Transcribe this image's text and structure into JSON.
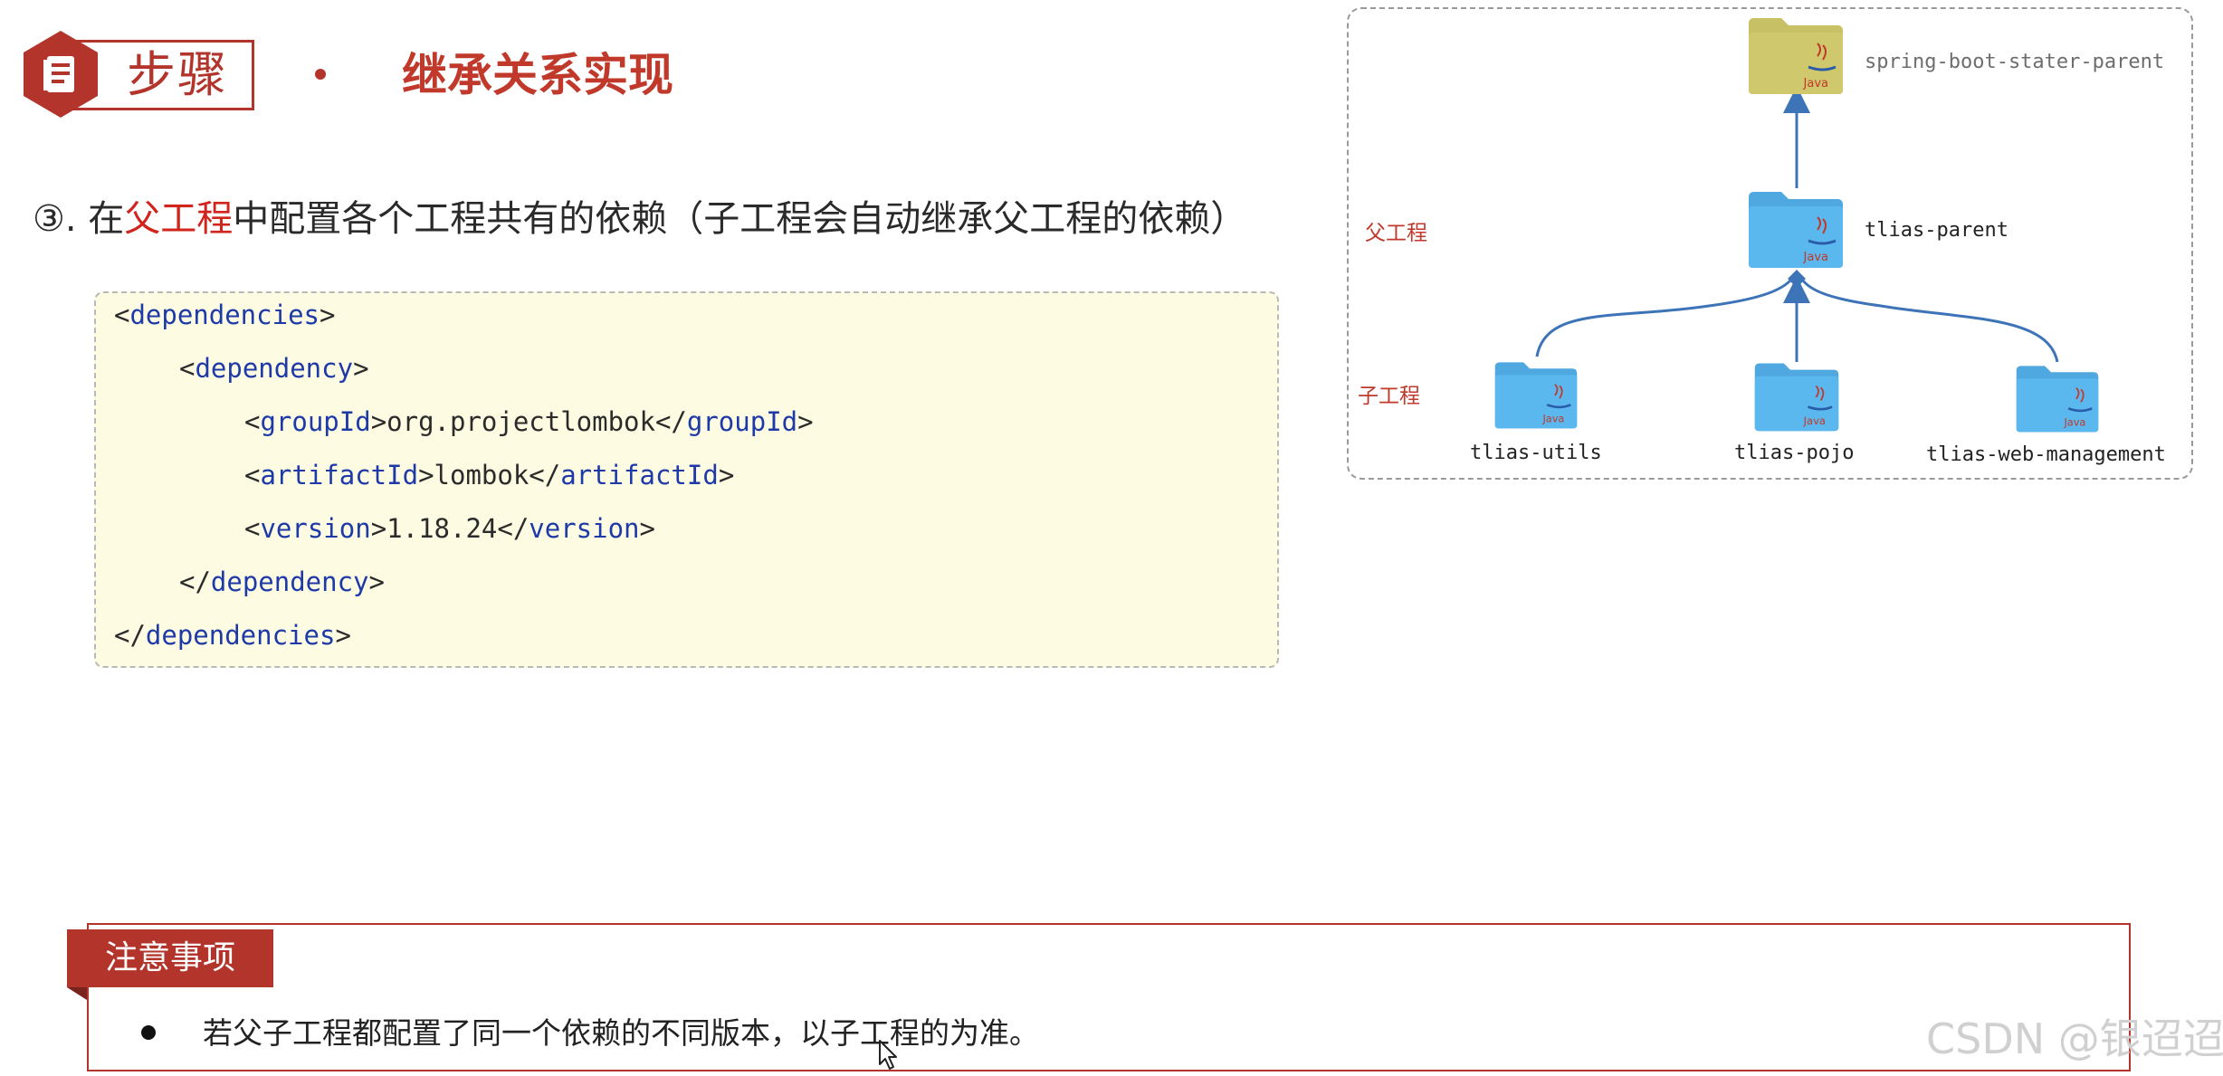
{
  "header": {
    "step_label": "步骤",
    "title": "继承关系实现"
  },
  "instruction": {
    "prefix": "③. 在",
    "highlight": "父工程",
    "suffix": "中配置各个工程共有的依赖（子工程会自动继承父工程的依赖）"
  },
  "code": {
    "lines": [
      {
        "before": "<",
        "tag": "dependencies",
        "middle": ">",
        "tag2": "",
        "after": ""
      },
      {
        "before": "<",
        "tag": "dependency",
        "middle": ">",
        "tag2": "",
        "after": ""
      },
      {
        "before": "<",
        "tag": "groupId",
        "middle": ">org.projectlombok</",
        "tag2": "groupId",
        "after": ">"
      },
      {
        "before": "<",
        "tag": "artifactId",
        "middle": ">lombok</",
        "tag2": "artifactId",
        "after": ">"
      },
      {
        "before": "<",
        "tag": "version",
        "middle": ">1.18.24</",
        "tag2": "version",
        "after": ">"
      },
      {
        "before": "</",
        "tag": "dependency",
        "middle": ">",
        "tag2": "",
        "after": ""
      },
      {
        "before": "</",
        "tag": "dependencies",
        "middle": ">",
        "tag2": "",
        "after": ""
      }
    ]
  },
  "diagram": {
    "parent_group_label": "父工程",
    "child_group_label": "子工程",
    "nodes": {
      "root": {
        "label": "spring-boot-stater-parent",
        "badge": "Java",
        "color": "#c7c064"
      },
      "parent": {
        "label": "tlias-parent",
        "badge": "Java",
        "color": "#5ab8ee"
      },
      "child1": {
        "label": "tlias-utils",
        "badge": "Java",
        "color": "#5ab8ee"
      },
      "child2": {
        "label": "tlias-pojo",
        "badge": "Java",
        "color": "#5ab8ee"
      },
      "child3": {
        "label": "tlias-web-management",
        "badge": "Java",
        "color": "#5ab8ee"
      }
    },
    "arrow_color": "#3d74b8"
  },
  "notice": {
    "header": "注意事项",
    "text": "若父子工程都配置了同一个依赖的不同版本，以子工程的为准。"
  },
  "watermark": "CSDN @银迢迢",
  "colors": {
    "brand_red": "#b3342b",
    "highlight_red": "#d0241c",
    "code_tag_blue": "#1d3aa8",
    "code_bg": "#fdfbe1"
  }
}
